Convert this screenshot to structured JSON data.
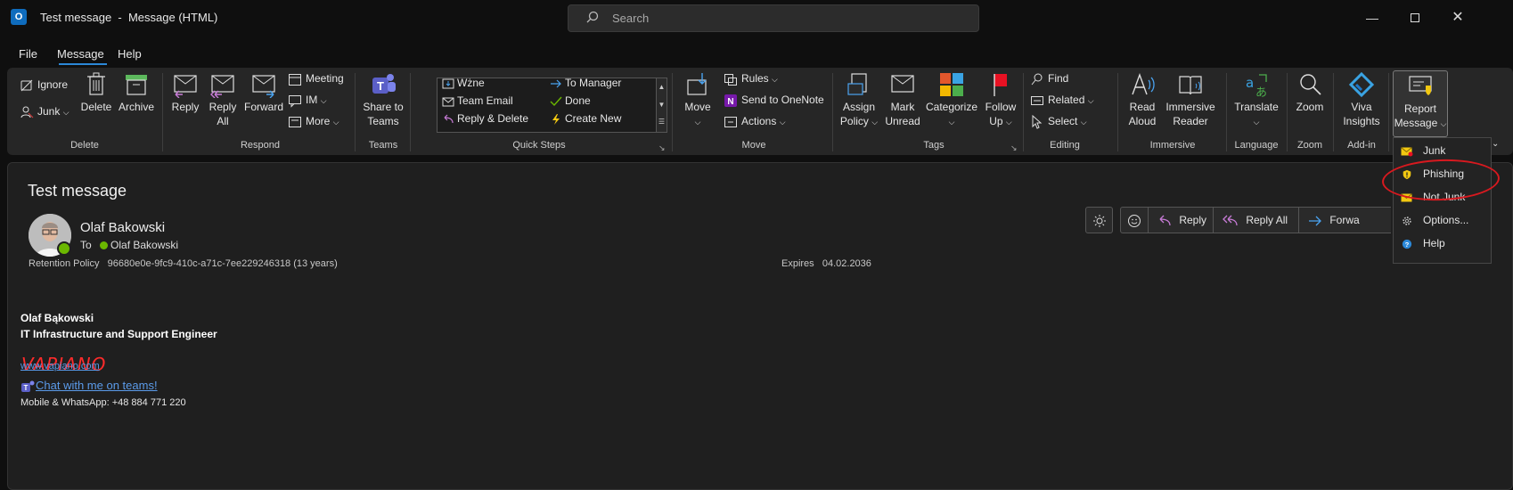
{
  "window": {
    "title": "Test message  -  Message (HTML)",
    "search_placeholder": "Search"
  },
  "menu": {
    "tabs": [
      "File",
      "Message",
      "Help"
    ],
    "active": "Message"
  },
  "ribbon": {
    "delete_group": {
      "label": "Delete",
      "ignore": "Ignore",
      "junk": "Junk",
      "delete": "Delete",
      "archive": "Archive"
    },
    "respond_group": {
      "label": "Respond",
      "reply": "Reply",
      "reply_all_line1": "Reply",
      "reply_all_line2": "All",
      "forward": "Forward",
      "meeting": "Meeting",
      "im": "IM",
      "more": "More"
    },
    "teams_group": {
      "label": "Teams",
      "share_line1": "Share to",
      "share_line2": "Teams"
    },
    "quick_steps": {
      "label": "Quick Steps",
      "items": [
        "Wżne",
        "To Manager",
        "Team Email",
        "Done",
        "Reply & Delete",
        "Create New"
      ]
    },
    "move_group": {
      "label": "Move",
      "move": "Move",
      "rules": "Rules",
      "send_onenote": "Send to OneNote",
      "actions": "Actions"
    },
    "tags_group": {
      "label": "Tags",
      "assign_line1": "Assign",
      "assign_line2": "Policy",
      "mark_line1": "Mark",
      "mark_line2": "Unread",
      "categorize": "Categorize",
      "follow_line1": "Follow",
      "follow_line2": "Up"
    },
    "editing_group": {
      "label": "Editing",
      "find": "Find",
      "related": "Related",
      "select": "Select"
    },
    "immersive_group": {
      "label": "Immersive",
      "read_line1": "Read",
      "read_line2": "Aloud",
      "reader_line1": "Immersive",
      "reader_line2": "Reader"
    },
    "language_group": {
      "label": "Language",
      "translate": "Translate"
    },
    "zoom_group": {
      "label": "Zoom",
      "zoom": "Zoom"
    },
    "addin_group": {
      "label": "Add-in",
      "viva_line1": "Viva",
      "viva_line2": "Insights"
    },
    "report": {
      "line1": "Report",
      "line2": "Message"
    }
  },
  "report_menu": {
    "items": [
      "Junk",
      "Phishing",
      "Not Junk",
      "Options...",
      "Help"
    ],
    "highlighted": "Phishing",
    "annotation_color": "#d8191f"
  },
  "message": {
    "subject": "Test message",
    "sender": "Olaf Bakowski",
    "to_label": "To",
    "to_name": "Olaf Bakowski",
    "retention_label": "Retention Policy",
    "retention_value": "96680e0e-9fc9-410c-a71c-7ee229246318 (13 years)",
    "expires_label": "Expires",
    "expires_value": "04.02.2036",
    "actions": {
      "reply": "Reply",
      "reply_all": "Reply All",
      "forward": "Forwa"
    }
  },
  "signature": {
    "name": "Olaf Bąkowski",
    "title": "IT Infrastructure and Support Engineer",
    "company_logo_text": "VAPIANO",
    "website": "www.vapiano.com",
    "teams_link": "Chat with me on teams!",
    "phone": "Mobile & WhatsApp: +48 884 771 220"
  },
  "colors": {
    "accent": "#2b88d8",
    "background": "#0f0f0f",
    "ribbon": "#262626",
    "pane": "#1f1f1f",
    "link": "#5b9bea",
    "logo": "#ff2b2b",
    "presence": "#6bb700"
  }
}
